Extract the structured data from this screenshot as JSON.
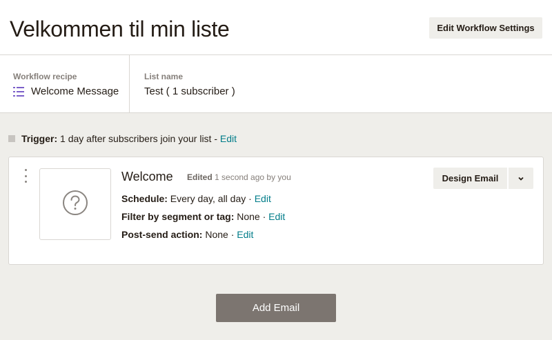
{
  "header": {
    "title": "Velkommen til min liste",
    "settings_button": "Edit Workflow Settings"
  },
  "info": {
    "recipe_label": "Workflow recipe",
    "recipe_value": "Welcome Message",
    "recipe_icon": "list-icon",
    "list_label": "List name",
    "list_value": "Test ( 1 subscriber )"
  },
  "trigger": {
    "label": "Trigger:",
    "text": " 1 day after subscribers join your list - ",
    "edit": "Edit"
  },
  "email": {
    "name": "Welcome",
    "edited_label": "Edited",
    "edited_text": " 1 second ago by you",
    "thumbnail_icon": "question-mark-icon",
    "schedule_label": "Schedule:",
    "schedule_value": " Every day, all day · ",
    "filter_label": "Filter by segment or tag:",
    "filter_value": " None · ",
    "postsend_label": "Post-send action:",
    "postsend_value": " None · ",
    "edit": "Edit",
    "design_button": "Design Email",
    "dropdown_icon": "chevron-down-icon"
  },
  "add_email_button": "Add Email",
  "colors": {
    "accent_link": "#007c89",
    "recipe_icon": "#7b5fc9",
    "add_button_bg": "#7c7570",
    "page_bg": "#efeeea"
  }
}
